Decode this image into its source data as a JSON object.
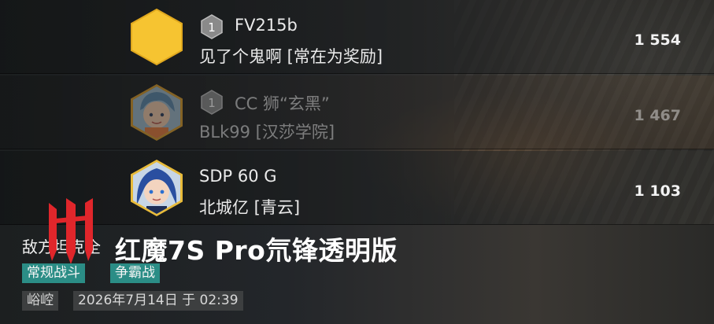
{
  "rows": [
    {
      "rank": "1",
      "name": "FV215b",
      "clan": "见了个鬼啊 [常在为奖励]",
      "score": "1 554",
      "avatar": "hexagon-gold"
    },
    {
      "rank": "1",
      "name": "CC 狮“玄黑”",
      "clan": "BLk99 [汉莎学院]",
      "score": "1 467",
      "avatar": "anime-avatar-female"
    },
    {
      "rank": "",
      "name": "SDP 60 G",
      "clan": "北城亿 [青云]",
      "score": "1 103",
      "avatar": "anime-avatar-blue-hair"
    }
  ],
  "footer": {
    "title": "敌方坦克全",
    "tags": [
      "常规战斗",
      "争霸战"
    ],
    "map": "峪崆",
    "datetime": "2026年7月14日 于 02:39"
  },
  "watermark": {
    "text": "红魔7S Pro氘锋透明版",
    "logo": "red-magic-logo"
  },
  "colors": {
    "tag_bg": "#2b8d86",
    "meta_bg": "#3d3f40",
    "gold": "#f4c430",
    "logo_red": "#e0262b"
  }
}
